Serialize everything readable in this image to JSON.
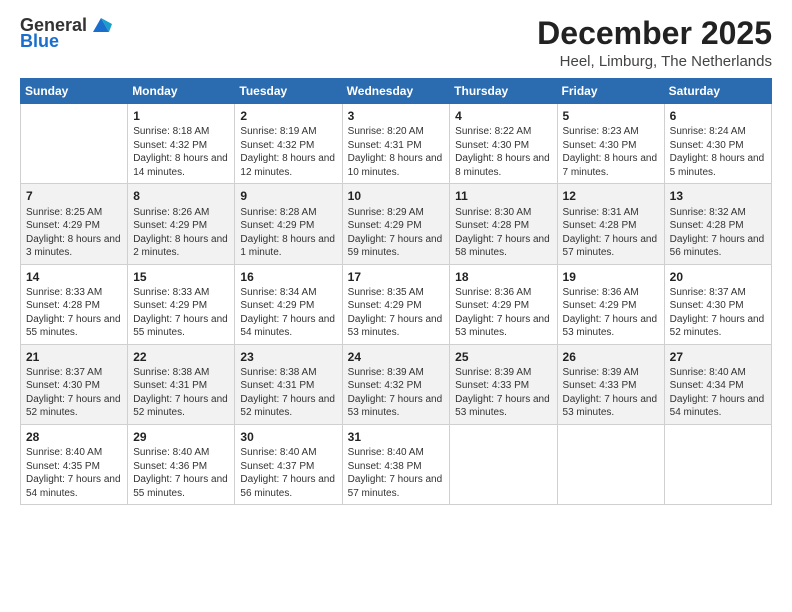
{
  "logo": {
    "text_general": "General",
    "text_blue": "Blue"
  },
  "title": "December 2025",
  "subtitle": "Heel, Limburg, The Netherlands",
  "weekdays": [
    "Sunday",
    "Monday",
    "Tuesday",
    "Wednesday",
    "Thursday",
    "Friday",
    "Saturday"
  ],
  "weeks": [
    [
      {
        "day": "",
        "sunrise": "",
        "sunset": "",
        "daylight": ""
      },
      {
        "day": "1",
        "sunrise": "Sunrise: 8:18 AM",
        "sunset": "Sunset: 4:32 PM",
        "daylight": "Daylight: 8 hours and 14 minutes."
      },
      {
        "day": "2",
        "sunrise": "Sunrise: 8:19 AM",
        "sunset": "Sunset: 4:32 PM",
        "daylight": "Daylight: 8 hours and 12 minutes."
      },
      {
        "day": "3",
        "sunrise": "Sunrise: 8:20 AM",
        "sunset": "Sunset: 4:31 PM",
        "daylight": "Daylight: 8 hours and 10 minutes."
      },
      {
        "day": "4",
        "sunrise": "Sunrise: 8:22 AM",
        "sunset": "Sunset: 4:30 PM",
        "daylight": "Daylight: 8 hours and 8 minutes."
      },
      {
        "day": "5",
        "sunrise": "Sunrise: 8:23 AM",
        "sunset": "Sunset: 4:30 PM",
        "daylight": "Daylight: 8 hours and 7 minutes."
      },
      {
        "day": "6",
        "sunrise": "Sunrise: 8:24 AM",
        "sunset": "Sunset: 4:30 PM",
        "daylight": "Daylight: 8 hours and 5 minutes."
      }
    ],
    [
      {
        "day": "7",
        "sunrise": "Sunrise: 8:25 AM",
        "sunset": "Sunset: 4:29 PM",
        "daylight": "Daylight: 8 hours and 3 minutes."
      },
      {
        "day": "8",
        "sunrise": "Sunrise: 8:26 AM",
        "sunset": "Sunset: 4:29 PM",
        "daylight": "Daylight: 8 hours and 2 minutes."
      },
      {
        "day": "9",
        "sunrise": "Sunrise: 8:28 AM",
        "sunset": "Sunset: 4:29 PM",
        "daylight": "Daylight: 8 hours and 1 minute."
      },
      {
        "day": "10",
        "sunrise": "Sunrise: 8:29 AM",
        "sunset": "Sunset: 4:29 PM",
        "daylight": "Daylight: 7 hours and 59 minutes."
      },
      {
        "day": "11",
        "sunrise": "Sunrise: 8:30 AM",
        "sunset": "Sunset: 4:28 PM",
        "daylight": "Daylight: 7 hours and 58 minutes."
      },
      {
        "day": "12",
        "sunrise": "Sunrise: 8:31 AM",
        "sunset": "Sunset: 4:28 PM",
        "daylight": "Daylight: 7 hours and 57 minutes."
      },
      {
        "day": "13",
        "sunrise": "Sunrise: 8:32 AM",
        "sunset": "Sunset: 4:28 PM",
        "daylight": "Daylight: 7 hours and 56 minutes."
      }
    ],
    [
      {
        "day": "14",
        "sunrise": "Sunrise: 8:33 AM",
        "sunset": "Sunset: 4:28 PM",
        "daylight": "Daylight: 7 hours and 55 minutes."
      },
      {
        "day": "15",
        "sunrise": "Sunrise: 8:33 AM",
        "sunset": "Sunset: 4:29 PM",
        "daylight": "Daylight: 7 hours and 55 minutes."
      },
      {
        "day": "16",
        "sunrise": "Sunrise: 8:34 AM",
        "sunset": "Sunset: 4:29 PM",
        "daylight": "Daylight: 7 hours and 54 minutes."
      },
      {
        "day": "17",
        "sunrise": "Sunrise: 8:35 AM",
        "sunset": "Sunset: 4:29 PM",
        "daylight": "Daylight: 7 hours and 53 minutes."
      },
      {
        "day": "18",
        "sunrise": "Sunrise: 8:36 AM",
        "sunset": "Sunset: 4:29 PM",
        "daylight": "Daylight: 7 hours and 53 minutes."
      },
      {
        "day": "19",
        "sunrise": "Sunrise: 8:36 AM",
        "sunset": "Sunset: 4:29 PM",
        "daylight": "Daylight: 7 hours and 53 minutes."
      },
      {
        "day": "20",
        "sunrise": "Sunrise: 8:37 AM",
        "sunset": "Sunset: 4:30 PM",
        "daylight": "Daylight: 7 hours and 52 minutes."
      }
    ],
    [
      {
        "day": "21",
        "sunrise": "Sunrise: 8:37 AM",
        "sunset": "Sunset: 4:30 PM",
        "daylight": "Daylight: 7 hours and 52 minutes."
      },
      {
        "day": "22",
        "sunrise": "Sunrise: 8:38 AM",
        "sunset": "Sunset: 4:31 PM",
        "daylight": "Daylight: 7 hours and 52 minutes."
      },
      {
        "day": "23",
        "sunrise": "Sunrise: 8:38 AM",
        "sunset": "Sunset: 4:31 PM",
        "daylight": "Daylight: 7 hours and 52 minutes."
      },
      {
        "day": "24",
        "sunrise": "Sunrise: 8:39 AM",
        "sunset": "Sunset: 4:32 PM",
        "daylight": "Daylight: 7 hours and 53 minutes."
      },
      {
        "day": "25",
        "sunrise": "Sunrise: 8:39 AM",
        "sunset": "Sunset: 4:33 PM",
        "daylight": "Daylight: 7 hours and 53 minutes."
      },
      {
        "day": "26",
        "sunrise": "Sunrise: 8:39 AM",
        "sunset": "Sunset: 4:33 PM",
        "daylight": "Daylight: 7 hours and 53 minutes."
      },
      {
        "day": "27",
        "sunrise": "Sunrise: 8:40 AM",
        "sunset": "Sunset: 4:34 PM",
        "daylight": "Daylight: 7 hours and 54 minutes."
      }
    ],
    [
      {
        "day": "28",
        "sunrise": "Sunrise: 8:40 AM",
        "sunset": "Sunset: 4:35 PM",
        "daylight": "Daylight: 7 hours and 54 minutes."
      },
      {
        "day": "29",
        "sunrise": "Sunrise: 8:40 AM",
        "sunset": "Sunset: 4:36 PM",
        "daylight": "Daylight: 7 hours and 55 minutes."
      },
      {
        "day": "30",
        "sunrise": "Sunrise: 8:40 AM",
        "sunset": "Sunset: 4:37 PM",
        "daylight": "Daylight: 7 hours and 56 minutes."
      },
      {
        "day": "31",
        "sunrise": "Sunrise: 8:40 AM",
        "sunset": "Sunset: 4:38 PM",
        "daylight": "Daylight: 7 hours and 57 minutes."
      },
      {
        "day": "",
        "sunrise": "",
        "sunset": "",
        "daylight": ""
      },
      {
        "day": "",
        "sunrise": "",
        "sunset": "",
        "daylight": ""
      },
      {
        "day": "",
        "sunrise": "",
        "sunset": "",
        "daylight": ""
      }
    ]
  ]
}
